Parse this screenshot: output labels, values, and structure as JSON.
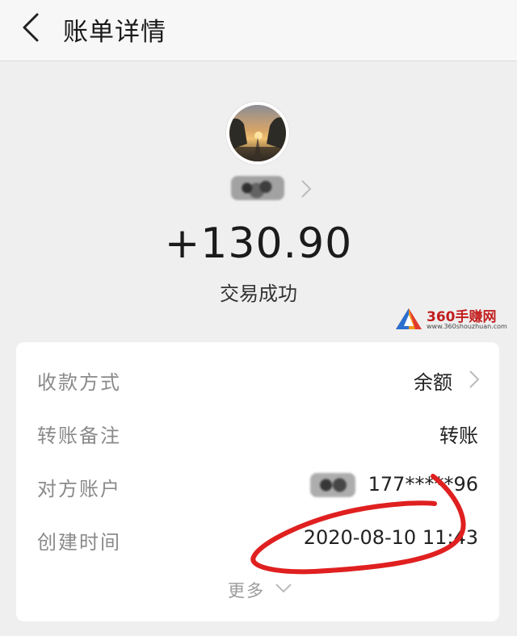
{
  "header": {
    "title": "账单详情"
  },
  "transaction": {
    "amount": "+130.90",
    "status": "交易成功"
  },
  "watermark": {
    "title": "360手赚网",
    "url": "www.360shouzhuan.com"
  },
  "details": {
    "rows": [
      {
        "label": "收款方式",
        "value": "余额"
      },
      {
        "label": "转账备注",
        "value": "转账"
      },
      {
        "label": "对方账户",
        "value": "177*****96"
      },
      {
        "label": "创建时间",
        "value": "2020-08-10 11:43"
      }
    ],
    "more_label": "更多"
  },
  "colors": {
    "background": "#efefef",
    "card": "#ffffff",
    "annotation": "#e02020",
    "watermark_red": "#c21e1e"
  },
  "icons": [
    "back-arrow-icon",
    "chevron-right-icon",
    "chevron-down-icon",
    "watermark-logo-icon"
  ]
}
